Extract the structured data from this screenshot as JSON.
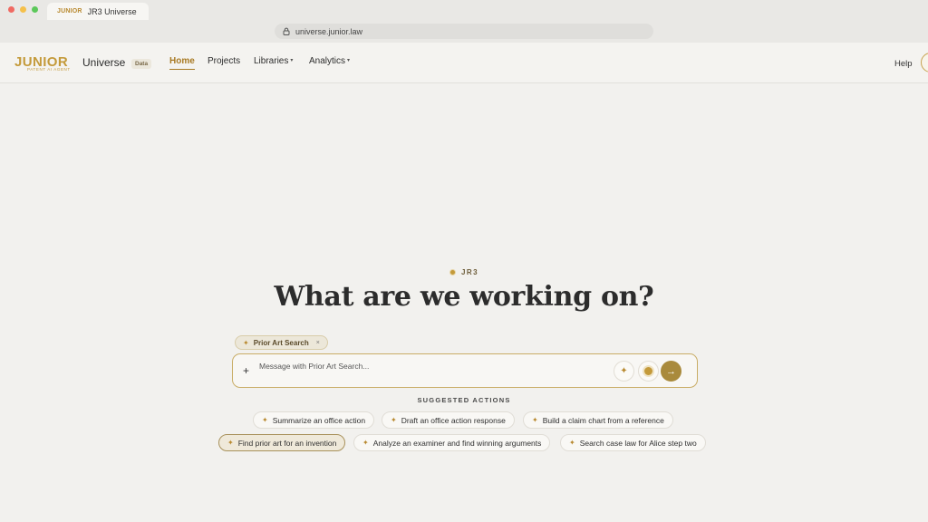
{
  "browser": {
    "tab": {
      "favicon_text": "JUNIOR",
      "title": "JR3 Universe"
    },
    "url": "universe.junior.law"
  },
  "header": {
    "logo": {
      "wordmark": "JUNIOR",
      "tagline": "PATENT AI AGENT"
    },
    "app_name": "Universe",
    "badge": "Data",
    "nav": [
      {
        "label": "Home",
        "active": true
      },
      {
        "label": "Projects",
        "active": false
      },
      {
        "label": "Libraries",
        "active": false,
        "dropdown": true
      },
      {
        "label": "Analytics",
        "active": false,
        "dropdown": true
      }
    ],
    "help": "Help"
  },
  "main": {
    "kicker": "JR3",
    "headline": "What are we working on?",
    "context_chip": {
      "label": "Prior Art Search",
      "close": "×"
    },
    "composer": {
      "placeholder": "Message with Prior Art Search...",
      "plus": "+",
      "sparkle": "✦",
      "send": "→"
    },
    "suggested_title": "SUGGESTED ACTIONS",
    "suggestions": [
      {
        "label": "Summarize an office action",
        "selected": false
      },
      {
        "label": "Draft an office action response",
        "selected": false
      },
      {
        "label": "Build a claim chart from a reference",
        "selected": false
      },
      {
        "label": "Find prior art for an invention",
        "selected": true
      },
      {
        "label": "Analyze an examiner and find winning arguments",
        "selected": false
      },
      {
        "label": "Search case law for Alice step two",
        "selected": false
      }
    ],
    "spark_glyph": "✦"
  },
  "colors": {
    "accent": "#a87a24",
    "gold": "#c49a3a",
    "background": "#f2f1ee"
  }
}
